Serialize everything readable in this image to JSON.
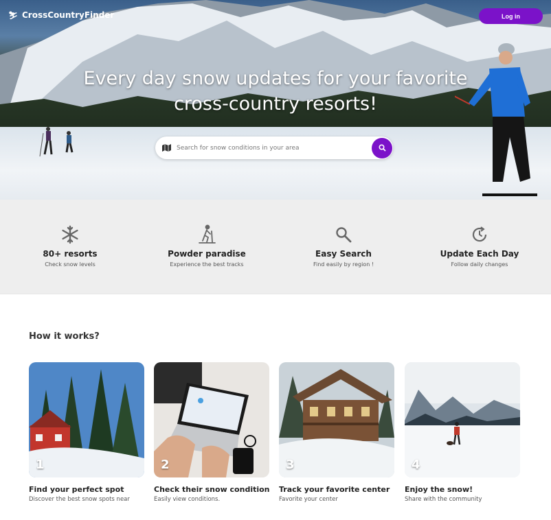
{
  "header": {
    "brand": "CrossCountryFinder",
    "login_label": "Log in"
  },
  "hero": {
    "title_line1": "Every day snow updates for your favorite",
    "title_line2": "cross-country resorts!",
    "search_placeholder": "Search for snow conditions in your area"
  },
  "features": [
    {
      "icon": "snowflake-icon",
      "title": "80+ resorts",
      "subtitle": "Check snow levels"
    },
    {
      "icon": "skier-icon",
      "title": "Powder paradise",
      "subtitle": "Experience the best tracks"
    },
    {
      "icon": "search-icon",
      "title": "Easy Search",
      "subtitle": "Find easily by region !"
    },
    {
      "icon": "history-clock-icon",
      "title": "Update Each Day",
      "subtitle": "Follow daily changes"
    }
  ],
  "how_it_works": {
    "title": "How it works?",
    "steps": [
      {
        "number": "1",
        "title": "Find your perfect spot",
        "subtitle": "Discover the best snow spots near"
      },
      {
        "number": "2",
        "title": "Check their snow condition",
        "subtitle": "Easily view conditions."
      },
      {
        "number": "3",
        "title": "Track your favorite center",
        "subtitle": "Favorite your center"
      },
      {
        "number": "4",
        "title": "Enjoy the snow!",
        "subtitle": "Share with the community"
      }
    ]
  },
  "colors": {
    "accent": "#7b12c9",
    "feature_bg": "#eeeeee"
  }
}
